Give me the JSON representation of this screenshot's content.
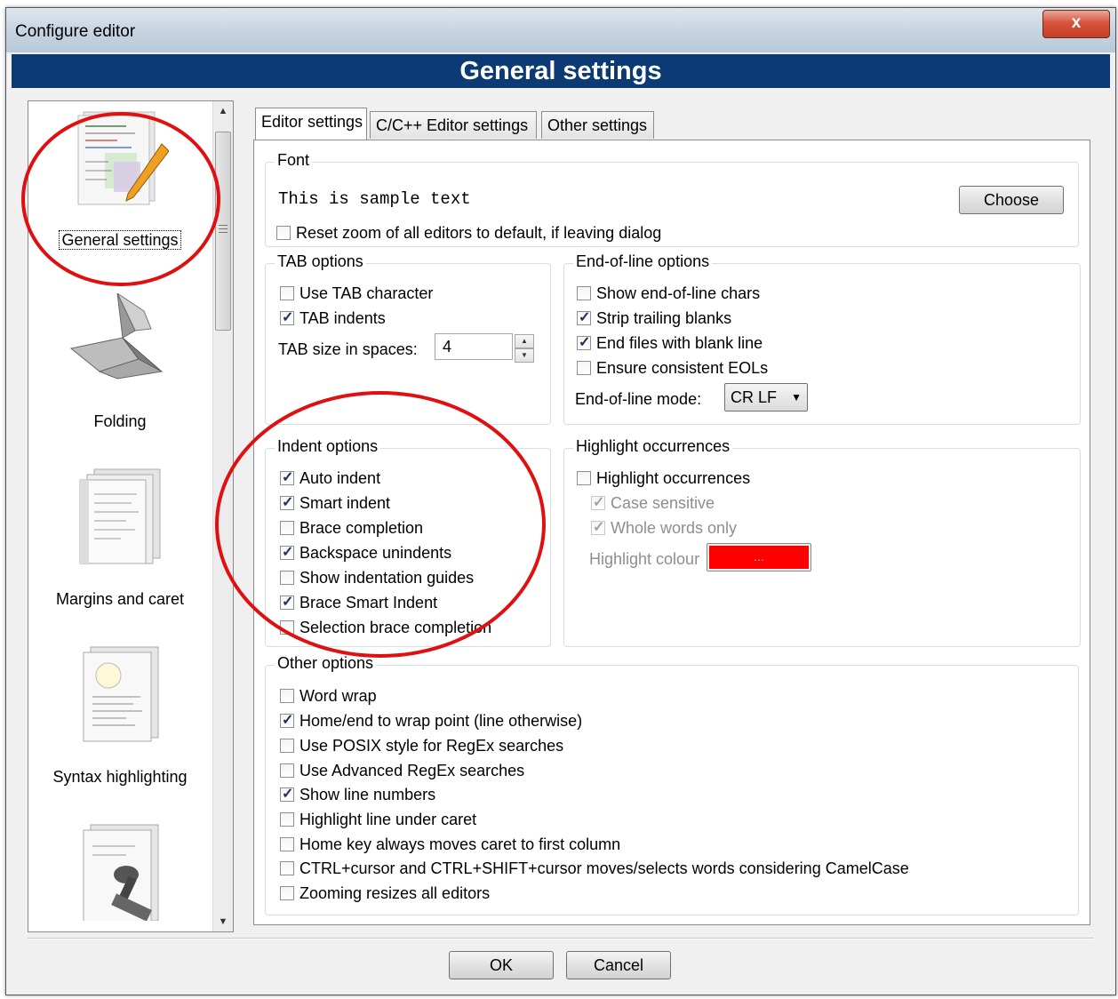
{
  "window": {
    "title": "Configure editor",
    "close_label": "x"
  },
  "header": {
    "title": "General settings"
  },
  "sidebar": {
    "items": [
      {
        "label": "General settings",
        "icon": "settings-document-pencil-icon",
        "selected": true
      },
      {
        "label": "Folding",
        "icon": "origami-bird-icon",
        "selected": false
      },
      {
        "label": "Margins and caret",
        "icon": "document-pages-icon",
        "selected": false
      },
      {
        "label": "Syntax highlighting",
        "icon": "lightbulb-document-icon",
        "selected": false
      },
      {
        "label": "",
        "icon": "stamp-document-icon",
        "selected": false
      }
    ]
  },
  "tabs": [
    {
      "label": "Editor settings",
      "active": true
    },
    {
      "label": "C/C++ Editor settings",
      "active": false
    },
    {
      "label": "Other settings",
      "active": false
    }
  ],
  "font": {
    "group_title": "Font",
    "sample_text": "This is sample text",
    "choose_label": "Choose",
    "reset_zoom": {
      "label": "Reset zoom of all editors to default, if leaving dialog",
      "checked": false
    }
  },
  "tab_options": {
    "group_title": "TAB options",
    "use_tab_char": {
      "label": "Use TAB character",
      "checked": false
    },
    "tab_indents": {
      "label": "TAB indents",
      "checked": true
    },
    "tab_size_label": "TAB size in spaces:",
    "tab_size_value": "4"
  },
  "eol_options": {
    "group_title": "End-of-line options",
    "show_eol": {
      "label": "Show end-of-line chars",
      "checked": false
    },
    "strip_trailing": {
      "label": "Strip trailing blanks",
      "checked": true
    },
    "end_blank_line": {
      "label": "End files with blank line",
      "checked": true
    },
    "consistent_eol": {
      "label": "Ensure consistent EOLs",
      "checked": false
    },
    "mode_label": "End-of-line mode:",
    "mode_value": "CR LF"
  },
  "indent_options": {
    "group_title": "Indent options",
    "items": [
      {
        "label": "Auto indent",
        "checked": true
      },
      {
        "label": "Smart indent",
        "checked": true
      },
      {
        "label": "Brace completion",
        "checked": false
      },
      {
        "label": "Backspace unindents",
        "checked": true
      },
      {
        "label": "Show indentation guides",
        "checked": false
      },
      {
        "label": "Brace Smart Indent",
        "checked": true
      },
      {
        "label": "Selection brace completion",
        "checked": false
      }
    ]
  },
  "highlight": {
    "group_title": "Highlight occurrences",
    "enable": {
      "label": "Highlight occurrences",
      "checked": false
    },
    "case_sensitive": {
      "label": "Case sensitive",
      "checked": true
    },
    "whole_words": {
      "label": "Whole words only",
      "checked": true
    },
    "colour_label": "Highlight colour",
    "colour_button_label": "...",
    "colour_value": "#ff0000"
  },
  "other_options": {
    "group_title": "Other options",
    "items": [
      {
        "label": "Word wrap",
        "checked": false
      },
      {
        "label": "Home/end to wrap point (line otherwise)",
        "checked": true
      },
      {
        "label": "Use POSIX style for RegEx searches",
        "checked": false
      },
      {
        "label": "Use Advanced RegEx searches",
        "checked": false
      },
      {
        "label": "Show line numbers",
        "checked": true
      },
      {
        "label": "Highlight line under caret",
        "checked": false
      },
      {
        "label": "Home key always moves caret to first column",
        "checked": false
      },
      {
        "label": "CTRL+cursor and CTRL+SHIFT+cursor moves/selects words considering CamelCase",
        "checked": false
      },
      {
        "label": "Zooming resizes all editors",
        "checked": false
      }
    ]
  },
  "footer": {
    "ok_label": "OK",
    "cancel_label": "Cancel"
  },
  "colors": {
    "header_bg": "#0c3a74",
    "annotation_red": "#e01010"
  }
}
